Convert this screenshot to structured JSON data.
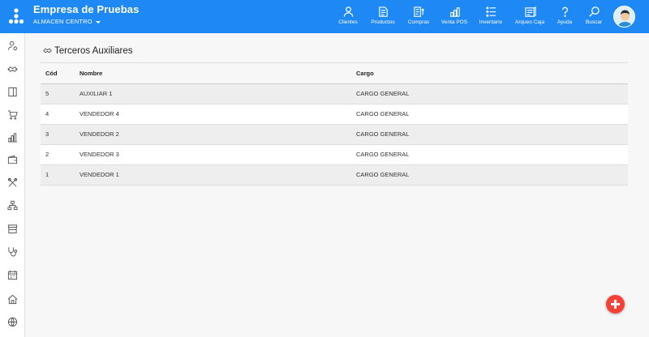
{
  "header": {
    "company": "Empresa de Pruebas",
    "store": "ALMACEN CENTRO",
    "nav": [
      {
        "label": "Clientes",
        "icon": "person-icon"
      },
      {
        "label": "Productos",
        "icon": "products-icon"
      },
      {
        "label": "Compras",
        "icon": "purchases-icon"
      },
      {
        "label": "Venta POS",
        "icon": "pos-sale-icon"
      },
      {
        "label": "Inventario",
        "icon": "inventory-icon"
      },
      {
        "label": "Arqueo Caja",
        "icon": "cash-count-icon"
      },
      {
        "label": "Ayuda",
        "icon": "help-icon"
      },
      {
        "label": "Buscar",
        "icon": "search-icon"
      }
    ],
    "brand_color": "#1e88f5"
  },
  "sidebar": {
    "items": [
      {
        "icon": "user-settings-icon"
      },
      {
        "icon": "handshake-icon"
      },
      {
        "icon": "book-icon"
      },
      {
        "icon": "cart-icon"
      },
      {
        "icon": "chart-icon"
      },
      {
        "icon": "wallet-icon"
      },
      {
        "icon": "tools-icon"
      },
      {
        "icon": "org-chart-icon"
      },
      {
        "icon": "store-icon"
      },
      {
        "icon": "stethoscope-icon"
      },
      {
        "icon": "calendar-icon"
      },
      {
        "icon": "home-icon"
      },
      {
        "icon": "globe-icon"
      }
    ]
  },
  "main": {
    "title": "Terceros Auxiliares",
    "columns": [
      "Cód",
      "Nombre",
      "Cargo"
    ],
    "rows": [
      {
        "cod": "5",
        "nombre": "AUXILIAR 1",
        "cargo": "CARGO GENERAL"
      },
      {
        "cod": "4",
        "nombre": "VENDEDOR 4",
        "cargo": "CARGO GENERAL"
      },
      {
        "cod": "3",
        "nombre": "VENDEDOR 2",
        "cargo": "CARGO GENERAL"
      },
      {
        "cod": "2",
        "nombre": "VENDEDOR 3",
        "cargo": "CARGO GENERAL"
      },
      {
        "cod": "1",
        "nombre": "VENDEDOR 1",
        "cargo": "CARGO GENERAL"
      }
    ]
  },
  "fab": {
    "icon": "plus-icon",
    "color": "#f44336"
  }
}
